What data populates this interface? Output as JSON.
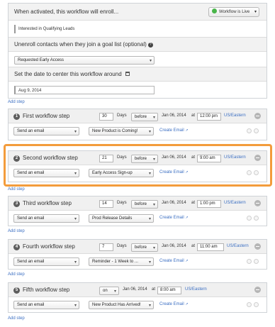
{
  "settings": {
    "enroll_label": "When activated, this workflow will enroll...",
    "live_label": "Workflow is Live",
    "list_value": "Interested in Qualifying Leads",
    "unenroll_label": "Unenroll contacts when they join a goal list (optional)",
    "help_icon_glyph": "?",
    "goal_list_value": "Requested Early Access",
    "center_date_label": "Set the date to center this workflow around",
    "center_date_value": "Aug 9, 2014"
  },
  "add_step_label": "Add step",
  "steps": [
    {
      "number": "1",
      "title": "First workflow step",
      "offset": "30",
      "days_label": "Days",
      "relation": "before",
      "date": "Jan 06, 2014",
      "at_label": "at",
      "time": "12:00 pm",
      "timezone": "US/Eastern",
      "action": "Send an email",
      "email": "New Product is Coming!",
      "create_email": "Create Email"
    },
    {
      "number": "2",
      "title": "Second workflow step",
      "offset": "21",
      "days_label": "Days",
      "relation": "before",
      "date": "Jan 06, 2014",
      "at_label": "at",
      "time": "9:00 am",
      "timezone": "US/Eastern",
      "action": "Send an email",
      "email": "Early Access Sign-up",
      "create_email": "Create Email"
    },
    {
      "number": "3",
      "title": "Third workflow step",
      "offset": "14",
      "days_label": "Days",
      "relation": "before",
      "date": "Jan 06, 2014",
      "at_label": "at",
      "time": "1:00 pm",
      "timezone": "US/Eastern",
      "action": "Send an email",
      "email": "Prod Release Details",
      "create_email": "Create Email"
    },
    {
      "number": "4",
      "title": "Fourth workflow step",
      "offset": "7",
      "days_label": "Days",
      "relation": "before",
      "date": "Jan 06, 2014",
      "at_label": "at",
      "time": "11:00 am",
      "timezone": "US/Eastern",
      "action": "Send an email",
      "email": "Reminder - 1 Week to ...",
      "create_email": "Create Email"
    },
    {
      "number": "5",
      "title": "Fifth workflow step",
      "relation": "on",
      "date": "Jan 06, 2014",
      "at_label": "at",
      "time": "8:00 am",
      "timezone": "US/Eastern",
      "action": "Send an email",
      "email": "New Product Has Arrived!",
      "create_email": "Create Email"
    }
  ],
  "colors": {
    "accent": "#3a6ec2",
    "live": "#49b54a",
    "highlight": "#f39c3c"
  }
}
